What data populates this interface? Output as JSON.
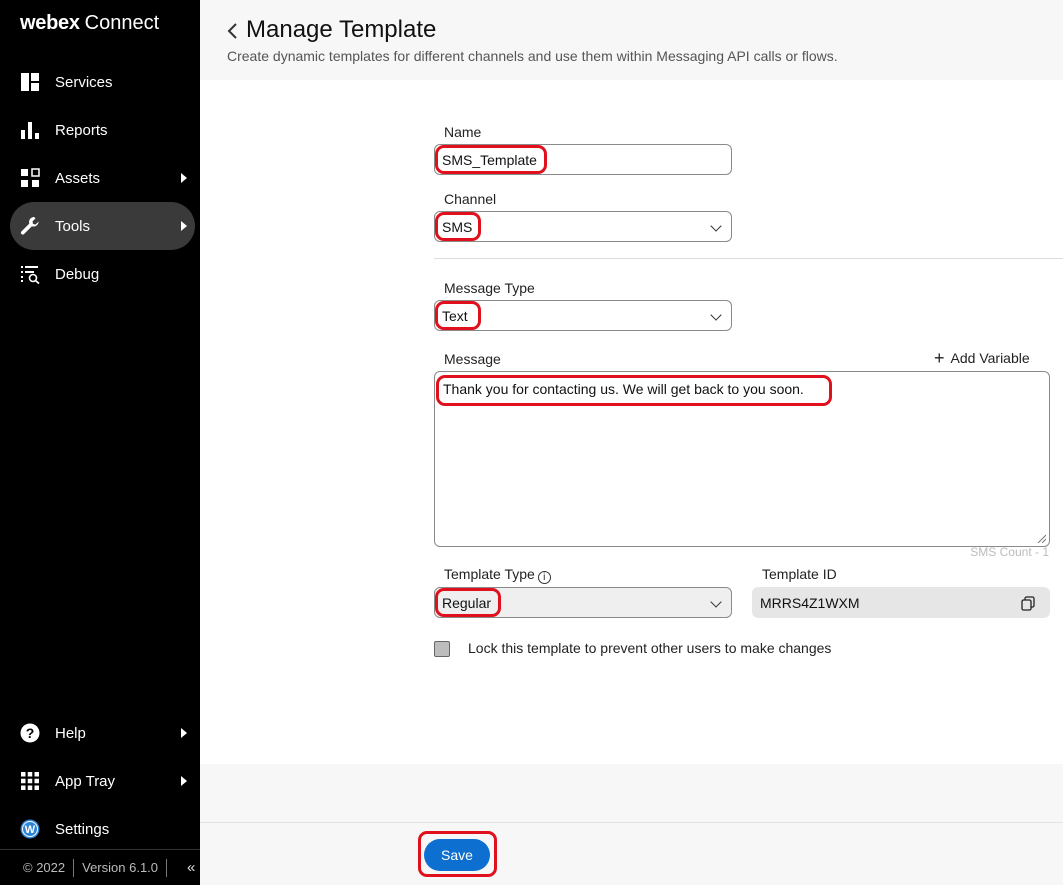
{
  "brand": {
    "name_bold": "webex",
    "name_light": "Connect"
  },
  "sidebar": {
    "items": [
      {
        "label": "Services",
        "icon": "services-icon",
        "has_submenu": false
      },
      {
        "label": "Reports",
        "icon": "reports-icon",
        "has_submenu": false
      },
      {
        "label": "Assets",
        "icon": "assets-icon",
        "has_submenu": true
      },
      {
        "label": "Tools",
        "icon": "wrench-icon",
        "has_submenu": true,
        "active": true
      },
      {
        "label": "Debug",
        "icon": "debug-icon",
        "has_submenu": false
      }
    ],
    "bottom_items": [
      {
        "label": "Help",
        "icon": "help-icon",
        "has_submenu": true
      },
      {
        "label": "App Tray",
        "icon": "grid-icon",
        "has_submenu": true
      },
      {
        "label": "Settings",
        "icon": "webex-logo-icon",
        "has_submenu": false
      }
    ],
    "footer": {
      "copyright": "© 2022",
      "version": "Version 6.1.0"
    }
  },
  "header": {
    "title": "Manage Template",
    "subtitle": "Create dynamic templates for different channels and use them within Messaging API calls or flows."
  },
  "form": {
    "name_label": "Name",
    "name_value": "SMS_Template",
    "channel_label": "Channel",
    "channel_value": "SMS",
    "message_type_label": "Message Type",
    "message_type_value": "Text",
    "message_label": "Message",
    "add_variable_label": "Add Variable",
    "message_value": "Thank you for contacting us. We will get back to you soon.",
    "sms_count": "SMS Count - 1",
    "template_type_label": "Template Type",
    "template_type_value": "Regular",
    "template_id_label": "Template ID",
    "template_id_value": "MRRS4Z1WXM",
    "lock_label": "Lock this template to prevent other users to make changes",
    "lock_checked": false
  },
  "actions": {
    "save_label": "Save"
  },
  "colors": {
    "sidebar_bg": "#000000",
    "active_nav": "#3a3a3a",
    "primary": "#0d6fd0",
    "highlight": "#e0101c"
  }
}
